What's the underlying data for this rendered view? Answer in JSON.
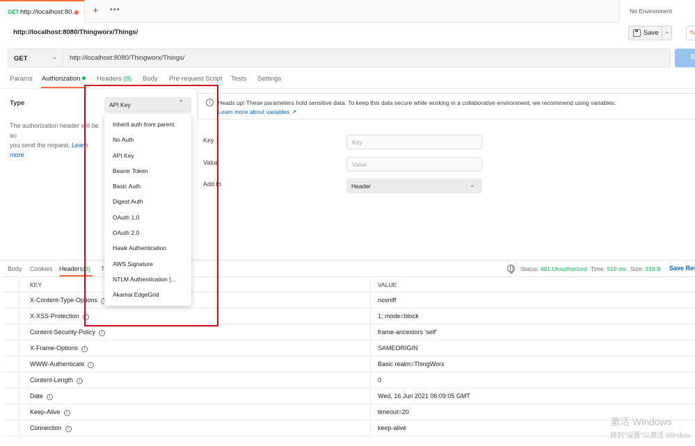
{
  "tab": {
    "method": "GET",
    "title": "http://localhost:80..."
  },
  "environment": "No Environment",
  "request": {
    "title": "http://localhost:8080/Thingworx/Things/",
    "method": "GET",
    "url": "http://localhost:8080/Thingworx/Things/",
    "save_label": "Save",
    "send_label": "S"
  },
  "request_tabs": {
    "params": "Params",
    "authorization": "Authorization",
    "headers": "Headers",
    "headers_count": "(8)",
    "body": "Body",
    "prerequest": "Pre-request Script",
    "tests": "Tests",
    "settings": "Settings"
  },
  "auth": {
    "type_label": "Type",
    "type_value": "API Key",
    "description": "The authorization header will be au",
    "description_line2": "you send the request. ",
    "description_link": "Learn more",
    "info_text": "Heads up! These parameters hold sensitive data. To keep this data secure while working in a collaborative environment, we recommend using variables.",
    "info_link": "Learn more about variables ↗",
    "key_label": "Key",
    "key_placeholder": "Key",
    "value_label": "Value",
    "value_placeholder": "Value",
    "addto_label": "Add to",
    "addto_value": "Header"
  },
  "auth_options": [
    "Inherit auth from parent",
    "No Auth",
    "API Key",
    "Bearer Token",
    "Basic Auth",
    "Digest Auth",
    "OAuth 1.0",
    "OAuth 2.0",
    "Hawk Authentication",
    "AWS Signature",
    "NTLM Authentication [...",
    "Akamai EdgeGrid"
  ],
  "response": {
    "tabs": {
      "body": "Body",
      "cookies": "Cookies",
      "headers": "Headers",
      "headers_count": "(9)",
      "tests": "Te"
    },
    "status_label": "Status:",
    "status_value": "401 Unauthorized",
    "time_label": "Time:",
    "time_value": "510 ms",
    "size_label": "Size:",
    "size_value": "318 B",
    "save_label": "Save Res",
    "columns": {
      "key": "KEY",
      "value": "VALUE"
    },
    "headers": [
      {
        "key": "X-Content-Type-Options",
        "value": "nosniff"
      },
      {
        "key": "X-XSS-Protection",
        "value": "1; mode=block"
      },
      {
        "key": "Content-Security-Policy",
        "value": "frame-ancestors 'self'"
      },
      {
        "key": "X-Frame-Options",
        "value": "SAMEORIGIN"
      },
      {
        "key": "WWW-Authenticate",
        "value": "Basic realm=ThingWorx"
      },
      {
        "key": "Content-Length",
        "value": "0"
      },
      {
        "key": "Date",
        "value": "Wed, 16 Jun 2021 06:09:05 GMT"
      },
      {
        "key": "Keep-Alive",
        "value": "timeout=20"
      },
      {
        "key": "Connection",
        "value": "keep-alive"
      }
    ]
  },
  "watermark": {
    "line1": "激活 Windows",
    "line2": "转到\"设置\"以激活 Window"
  },
  "colors": {
    "accent": "#ff6c37",
    "green": "#0cbb52",
    "link": "#0265d2",
    "highlight": "#d9001b"
  }
}
